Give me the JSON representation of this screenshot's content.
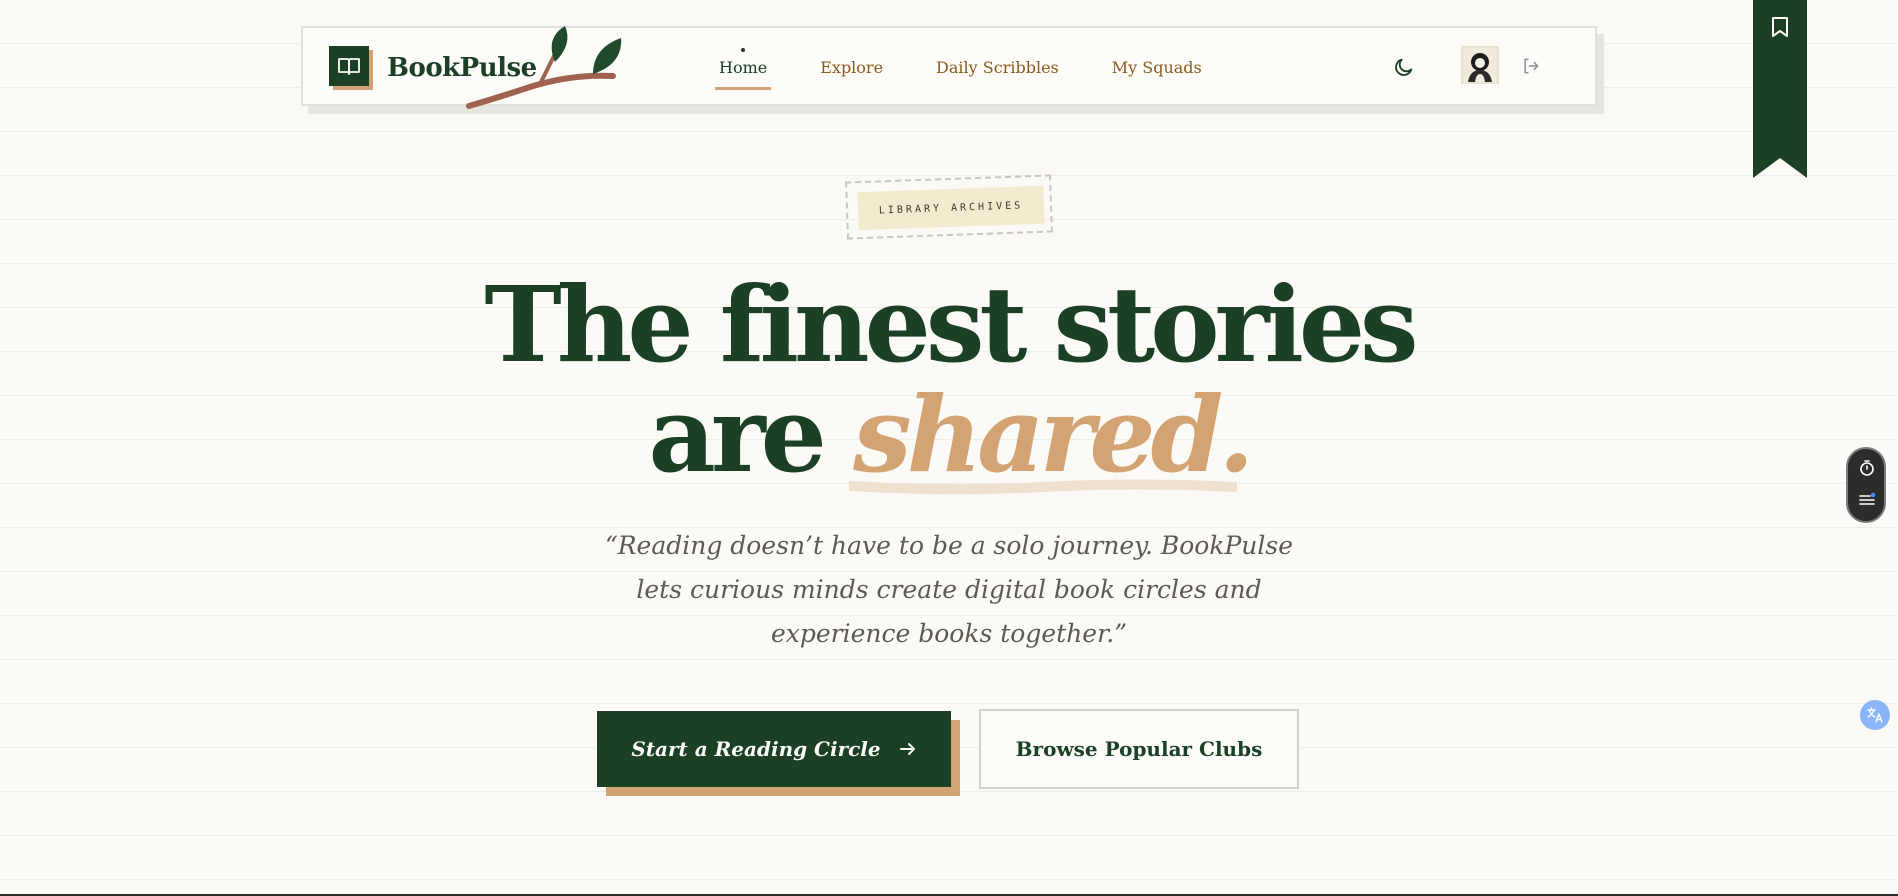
{
  "header": {
    "logo_text": "BookPulse",
    "nav": [
      {
        "label": "Home",
        "active": true
      },
      {
        "label": "Explore",
        "active": false
      },
      {
        "label": "Daily Scribbles",
        "active": false
      },
      {
        "label": "My Squads",
        "active": false
      }
    ]
  },
  "hero": {
    "tag": "LIBRARY ARCHIVES",
    "headline_line1": "The finest stories",
    "headline_line2_plain": "are ",
    "headline_line2_accent": "shared.",
    "quote": "“Reading doesn’t have to be a solo journey. BookPulse lets curious minds create digital book circles and experience books together.”",
    "cta_primary": "Start a Reading Circle",
    "cta_secondary": "Browse Popular Clubs"
  },
  "colors": {
    "brand_green": "#1b4025",
    "accent_tan": "#d4a373",
    "nav_brown": "#8a5a1e",
    "background": "#fbfaf6"
  },
  "icons": [
    "book-open-icon",
    "moon-icon",
    "logout-icon",
    "bookmark-icon",
    "arrow-right-icon",
    "timer-icon",
    "list-icon",
    "translate-icon"
  ]
}
